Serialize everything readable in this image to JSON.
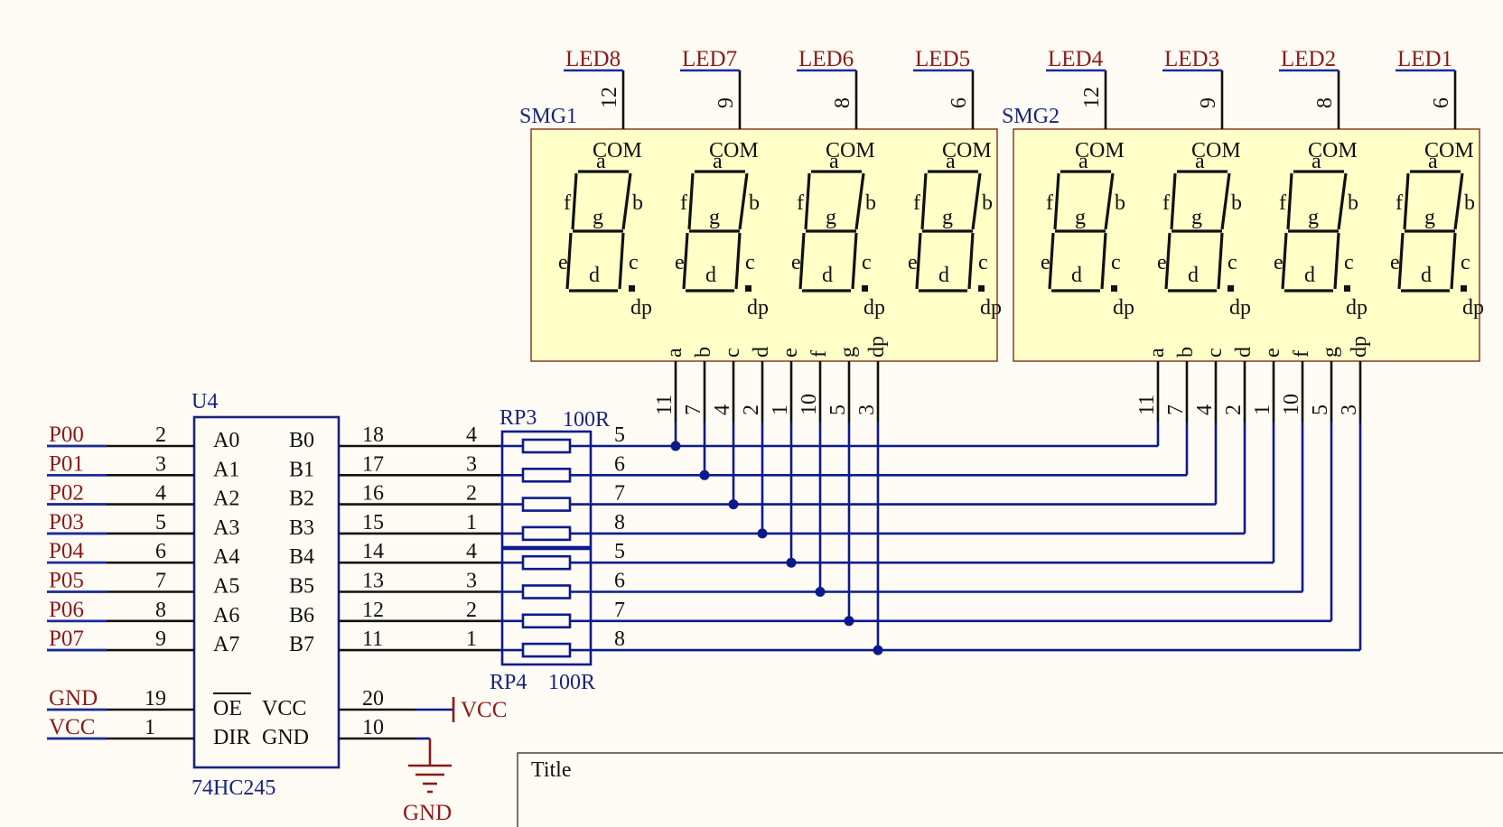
{
  "ic": {
    "designator": "U4",
    "part": "74HC245",
    "left_pins": [
      {
        "net": "P00",
        "num": "2",
        "name": "A0"
      },
      {
        "net": "P01",
        "num": "3",
        "name": "A1"
      },
      {
        "net": "P02",
        "num": "4",
        "name": "A2"
      },
      {
        "net": "P03",
        "num": "5",
        "name": "A3"
      },
      {
        "net": "P04",
        "num": "6",
        "name": "A4"
      },
      {
        "net": "P05",
        "num": "7",
        "name": "A5"
      },
      {
        "net": "P06",
        "num": "8",
        "name": "A6"
      },
      {
        "net": "P07",
        "num": "9",
        "name": "A7"
      }
    ],
    "right_pins": [
      {
        "num": "18",
        "name": "B0"
      },
      {
        "num": "17",
        "name": "B1"
      },
      {
        "num": "16",
        "name": "B2"
      },
      {
        "num": "15",
        "name": "B3"
      },
      {
        "num": "14",
        "name": "B4"
      },
      {
        "num": "13",
        "name": "B5"
      },
      {
        "num": "12",
        "name": "B6"
      },
      {
        "num": "11",
        "name": "B7"
      }
    ],
    "power_left": [
      {
        "net": "GND",
        "num": "19",
        "name": "OE"
      },
      {
        "net": "VCC",
        "num": "1",
        "name": "DIR"
      }
    ],
    "power_right": [
      {
        "num": "20",
        "name": "VCC",
        "net": "VCC"
      },
      {
        "num": "10",
        "name": "GND",
        "net": "GND"
      }
    ]
  },
  "resistor_networks": [
    {
      "designator": "RP3",
      "value": "100R",
      "left_pins": [
        "4",
        "3",
        "2",
        "1"
      ],
      "right_pins": [
        "5",
        "6",
        "7",
        "8"
      ]
    },
    {
      "designator": "RP4",
      "value": "100R",
      "left_pins": [
        "4",
        "3",
        "2",
        "1"
      ],
      "right_pins": [
        "5",
        "6",
        "7",
        "8"
      ]
    }
  ],
  "displays": [
    {
      "designator": "SMG1",
      "com_pins": [
        "12",
        "9",
        "8",
        "6"
      ],
      "leds": [
        "LED8",
        "LED7",
        "LED6",
        "LED5"
      ]
    },
    {
      "designator": "SMG2",
      "com_pins": [
        "12",
        "9",
        "8",
        "6"
      ],
      "leds": [
        "LED4",
        "LED3",
        "LED2",
        "LED1"
      ]
    }
  ],
  "digit_labels": {
    "com": "COM",
    "a": "a",
    "b": "b",
    "c": "c",
    "d": "d",
    "e": "e",
    "f": "f",
    "g": "g",
    "dp": "dp"
  },
  "segment_pins": [
    {
      "seg": "a",
      "num": "11"
    },
    {
      "seg": "b",
      "num": "7"
    },
    {
      "seg": "c",
      "num": "4"
    },
    {
      "seg": "d",
      "num": "2"
    },
    {
      "seg": "e",
      "num": "1"
    },
    {
      "seg": "f",
      "num": "10"
    },
    {
      "seg": "g",
      "num": "5"
    },
    {
      "seg": "dp",
      "num": "3"
    }
  ],
  "title_block": {
    "title_label": "Title"
  },
  "colors": {
    "net_label": "#8b1a1a",
    "wire": "#0d1a8c",
    "component": "#1a237e",
    "display_fill": "#ffffc8"
  }
}
